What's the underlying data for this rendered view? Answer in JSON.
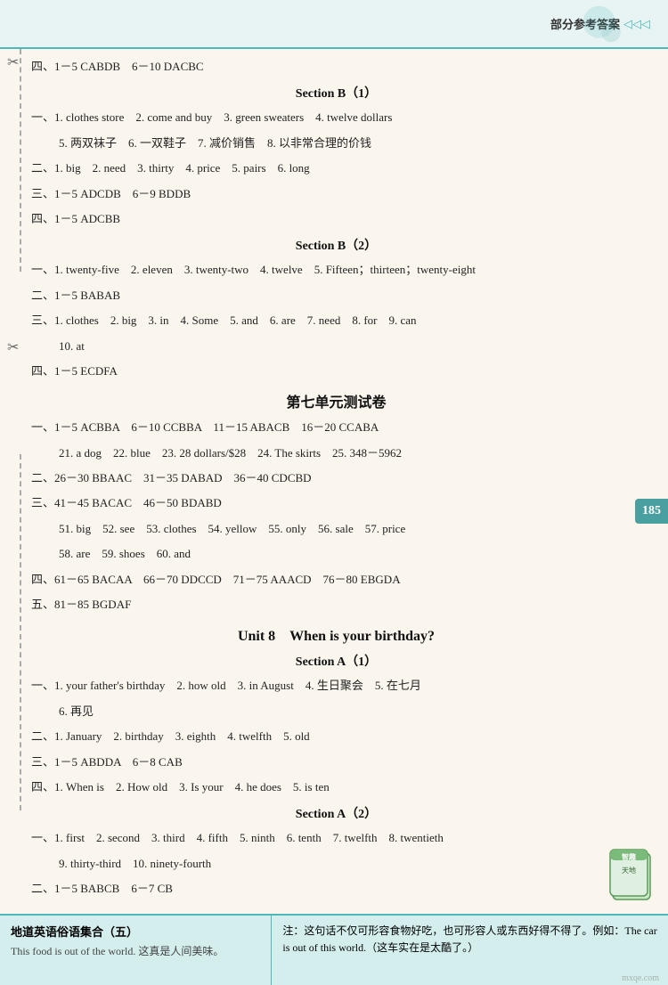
{
  "header": {
    "title": "部分参考答案",
    "arrows": "<<<",
    "page_number": "185"
  },
  "content": {
    "section_four_answers": "四、1－5 CABDB　6－10 DACBC",
    "section_b1_title": "Section B（1）",
    "b1_yi_1": "一、1. clothes store　2. come and buy　3. green sweaters　4. twelve dollars",
    "b1_yi_2": "　5. 两双袜子　6. 一双鞋子　7. 减价销售　8. 以非常合理的价钱",
    "b1_er": "二、1. big　2. need　3. thirty　4. price　5. pairs　6. long",
    "b1_san": "三、1－5 ADCDB　6－9 BDDB",
    "b1_si": "四、1－5 ADCBB",
    "section_b2_title": "Section B（2）",
    "b2_yi": "一、1. twenty-five　2. eleven　3. twenty-two　4. twelve　5. Fifteen；thirteen；twenty-eight",
    "b2_er": "二、1－5 BABAB",
    "b2_san_1": "三、1. clothes　2. big　3. in　4. Some　5. and　6. are　7. need　8. for　9. can",
    "b2_san_2": "　10. at",
    "b2_si": "四、1－5 ECDFA",
    "unit7_title": "第七单元测试卷",
    "u7_yi_1": "一、1－5 ACBBA　6－10 CCBBA　11－15 ABACB　16－20 CCABA",
    "u7_yi_2": "　21. a dog　22. blue　23. 28 dollars/$28　24. The skirts　25. 348－5962",
    "u7_er": "二、26－30 BBAAC　31－35 DABAD　36－40 CDCBD",
    "u7_san": "三、41－45 BACAC　46－50 BDABD",
    "u7_san_2": "　51. big　52. see　53. clothes　54. yellow　55. only　56. sale　57. price",
    "u7_san_3": "　58. are　59. shoes　60. and",
    "u7_si": "四、61－65 BACAA　66－70 DDCCD　71－75 AAACD　76－80 EBGDA",
    "u7_wu": "五、81－85 BGDAF",
    "unit8_title": "Unit 8　When is your birthday?",
    "section_a1_title": "Section A（1）",
    "a1_yi_1": "一、1. your father's birthday　2. how old　3. in August　4. 生日聚会　5. 在七月",
    "a1_yi_2": "　6. 再见",
    "a1_er": "二、1. January　2. birthday　3. eighth　4. twelfth　5. old",
    "a1_san": "三、1－5 ABDDA　6－8 CAB",
    "a1_si": "四、1. When is　2. How old　3. Is your　4. he does　5. is ten",
    "section_a2_title": "Section A（2）",
    "a2_yi_1": "一、1. first　2. second　3. third　4. fifth　5. ninth　6. tenth　7. twelfth　8. twentieth",
    "a2_yi_2": "　9. thirty-third　10. ninety-fourth",
    "a2_er": "二、1－5 BABCB　6－7 CB",
    "bottom_left_title": "地道英语俗语集合（五）",
    "bottom_left_english": "This food is out of the world. 这真是人间美味。",
    "bottom_right_note": "注：这句话不仅可形容食物好吃，也可形容人或东西好得不得了。例如：The car is out of this world.（这车实在是太酷了。）",
    "corner_label_1": "智",
    "corner_label_2": "趣",
    "corner_label_3": "天",
    "corner_label_4": "地",
    "watermark": "mxqe.com"
  }
}
